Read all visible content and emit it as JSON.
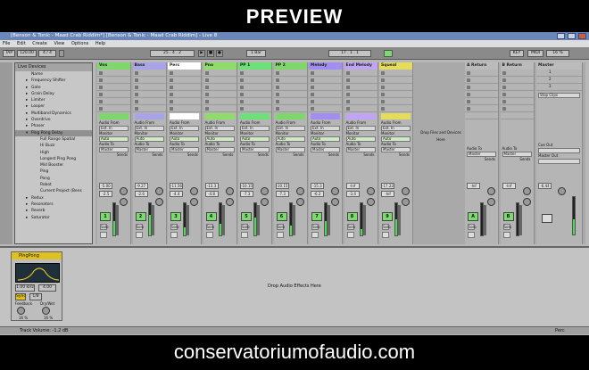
{
  "banner": {
    "top": "PREVIEW",
    "bottom": "conservatoriumofaudio.com"
  },
  "window": {
    "title": "[Benson & Tonic - Maad Crab Riddim*] [Benson & Tonic - Maad Crab Riddim] - Live 8"
  },
  "menu": [
    "File",
    "Edit",
    "Create",
    "View",
    "Options",
    "Help"
  ],
  "transport": {
    "tap": "TAP",
    "tempo": "120.00",
    "sig": "4 / 4",
    "quant": "1 Bar",
    "pos": "25 . 4 . 2",
    "pos2": "17 . 1 . 1",
    "key": "KEY",
    "midi": "MIDI",
    "cpu": "16 %"
  },
  "browser": {
    "header": "Live Devices",
    "items": [
      {
        "t": "Name",
        "k": "sub0"
      },
      {
        "t": "Frequency Shifter",
        "k": "i"
      },
      {
        "t": "Gate",
        "k": "i"
      },
      {
        "t": "Grain Delay",
        "k": "i"
      },
      {
        "t": "Limiter",
        "k": "i"
      },
      {
        "t": "Looper",
        "k": "i"
      },
      {
        "t": "Multiband Dynamics",
        "k": "i"
      },
      {
        "t": "Overdrive",
        "k": "i"
      },
      {
        "t": "Phaser",
        "k": "i"
      },
      {
        "t": "Ping Pong Delay",
        "k": "sel"
      },
      {
        "t": "Full Range Spatial",
        "k": "s"
      },
      {
        "t": "Hi Buzz",
        "k": "s"
      },
      {
        "t": "High",
        "k": "s"
      },
      {
        "t": "Longest Ping Pong",
        "k": "s"
      },
      {
        "t": "Mid Booster",
        "k": "s"
      },
      {
        "t": "Ping",
        "k": "s"
      },
      {
        "t": "Pong",
        "k": "s"
      },
      {
        "t": "Robot",
        "k": "s"
      },
      {
        "t": "Current Project (Bens",
        "k": "s"
      },
      {
        "t": "Redux",
        "k": "i"
      },
      {
        "t": "Resonators",
        "k": "i"
      },
      {
        "t": "Reverb",
        "k": "i"
      },
      {
        "t": "Saturator",
        "k": "i"
      }
    ]
  },
  "tracks": [
    {
      "name": "Vox",
      "color": "#7fd66b",
      "vol": "-5.00",
      "pan": "-2.5",
      "num": "1",
      "meter": 0.45
    },
    {
      "name": "Bass",
      "color": "#a9a4e8",
      "vol": "-9.27",
      "pan": "-2.6",
      "num": "2",
      "meter": 0.65
    },
    {
      "name": "Perc",
      "color": "#ffffff",
      "vol": "-11.56",
      "pan": "-4.4",
      "num": "3",
      "meter": 0.25
    },
    {
      "name": "Pno",
      "color": "#8fdc6b",
      "vol": "-13.3",
      "pan": "-4.8",
      "num": "4",
      "meter": 0.35
    },
    {
      "name": "PP 1",
      "color": "#6ee07a",
      "vol": "-10.15",
      "pan": "-7.3",
      "num": "5",
      "meter": 0.55
    },
    {
      "name": "PP 2",
      "color": "#7fd66b",
      "vol": "-10.15",
      "pan": "-7.3",
      "num": "6",
      "meter": 0.3
    },
    {
      "name": "Melody",
      "color": "#a18ef0",
      "vol": "-15.3",
      "pan": "-6.2",
      "num": "7",
      "meter": 0.45
    },
    {
      "name": "End Melody",
      "color": "#c2a4f5",
      "vol": "-Inf",
      "pan": "-3.4",
      "num": "8",
      "meter": 0.2
    },
    {
      "name": "Squeal",
      "color": "#e6dc5c",
      "vol": "-17.22",
      "pan": "-Inf",
      "num": "9",
      "meter": 0.5
    }
  ],
  "returns": [
    {
      "name": "A Return",
      "vol": "-Inf",
      "num": "A"
    },
    {
      "name": "B Return",
      "vol": "-Inf",
      "num": "B"
    }
  ],
  "master": {
    "name": "Master",
    "vol": "-6.44",
    "scenes": [
      "1",
      "2",
      "3"
    ],
    "stop": "Stop Clips"
  },
  "drop_files": "Drop Files and Devices Here",
  "labels": {
    "audio_from": "Audio From",
    "ext_in": "Ext. In",
    "monitor": "Monitor",
    "in": "In",
    "auto": "Auto",
    "off": "Off",
    "audio_to": "Audio To",
    "master": "Master",
    "sends": "Sends",
    "cue_out": "Cue Out",
    "master_out": "Master Out",
    "post": "Post",
    "solo": "Solo"
  },
  "device": {
    "title": "PingPong",
    "freq": "1.00 kHz",
    "width": "4.00",
    "sync": "Sync",
    "feedback": "Feedback",
    "drywet": "Dry/Wet",
    "fb_val": "16 %",
    "dw_val": "16 %",
    "note": "1/8"
  },
  "detail": {
    "drop": "Drop Audio Effects Here"
  },
  "status": {
    "text": "Track Volume: -1.2 dB",
    "right": "Perc"
  }
}
